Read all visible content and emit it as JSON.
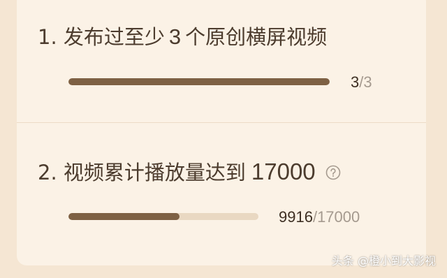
{
  "tasks": [
    {
      "prefix": "1. 发布过至少",
      "number": "3",
      "suffix": "个原创横屏视频",
      "progress": {
        "current": "3",
        "total": "/3",
        "fraction": 1.0
      }
    },
    {
      "prefix": "2. 视频累计播放量达到",
      "number": "17000",
      "has_help_icon": true,
      "progress": {
        "current": "9916",
        "total": "/17000",
        "fraction": 0.5833
      }
    }
  ],
  "colors": {
    "background": "#f5e6d3",
    "card": "#fbf2e6",
    "bar_fill": "#7e6144",
    "bar_track": "#e9d8c2",
    "text": "#4c3c2e",
    "muted": "#a59a8f"
  },
  "watermark": "头条 @橙小到大影视"
}
